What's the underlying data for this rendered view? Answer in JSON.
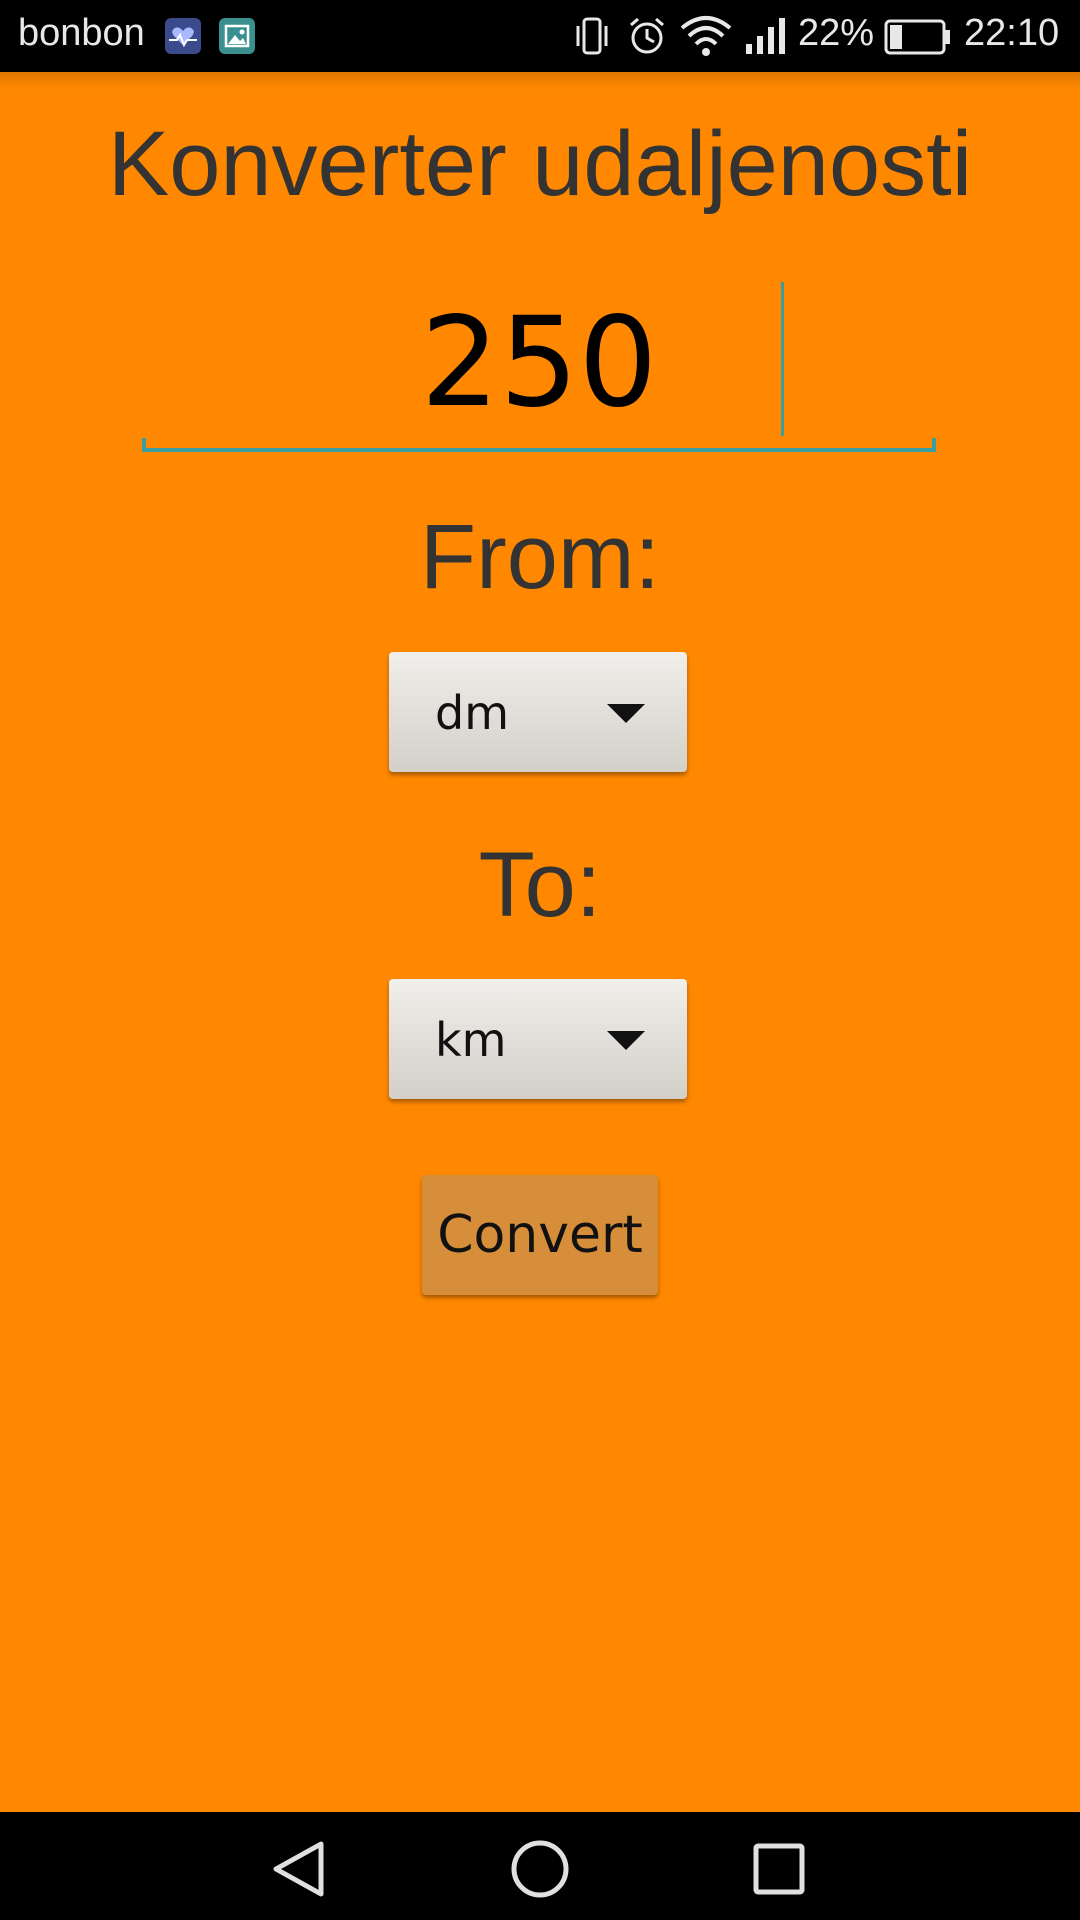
{
  "status_bar": {
    "carrier": "bonbon",
    "battery_percent": "22%",
    "time": "22:10",
    "icons": [
      "health-app-icon",
      "gallery-app-icon",
      "vibrate-icon",
      "alarm-icon",
      "wifi-icon",
      "signal-icon",
      "battery-icon"
    ]
  },
  "app": {
    "title": "Konverter udaljenosti",
    "value": "250",
    "from_label": "From:",
    "from_unit": "dm",
    "to_label": "To:",
    "to_unit": "km",
    "convert_label": "Convert",
    "background_color": "#ff8800",
    "accent_color": "#3a9da1"
  },
  "nav_bar": {
    "buttons": [
      "back-icon",
      "home-icon",
      "recents-icon"
    ]
  }
}
